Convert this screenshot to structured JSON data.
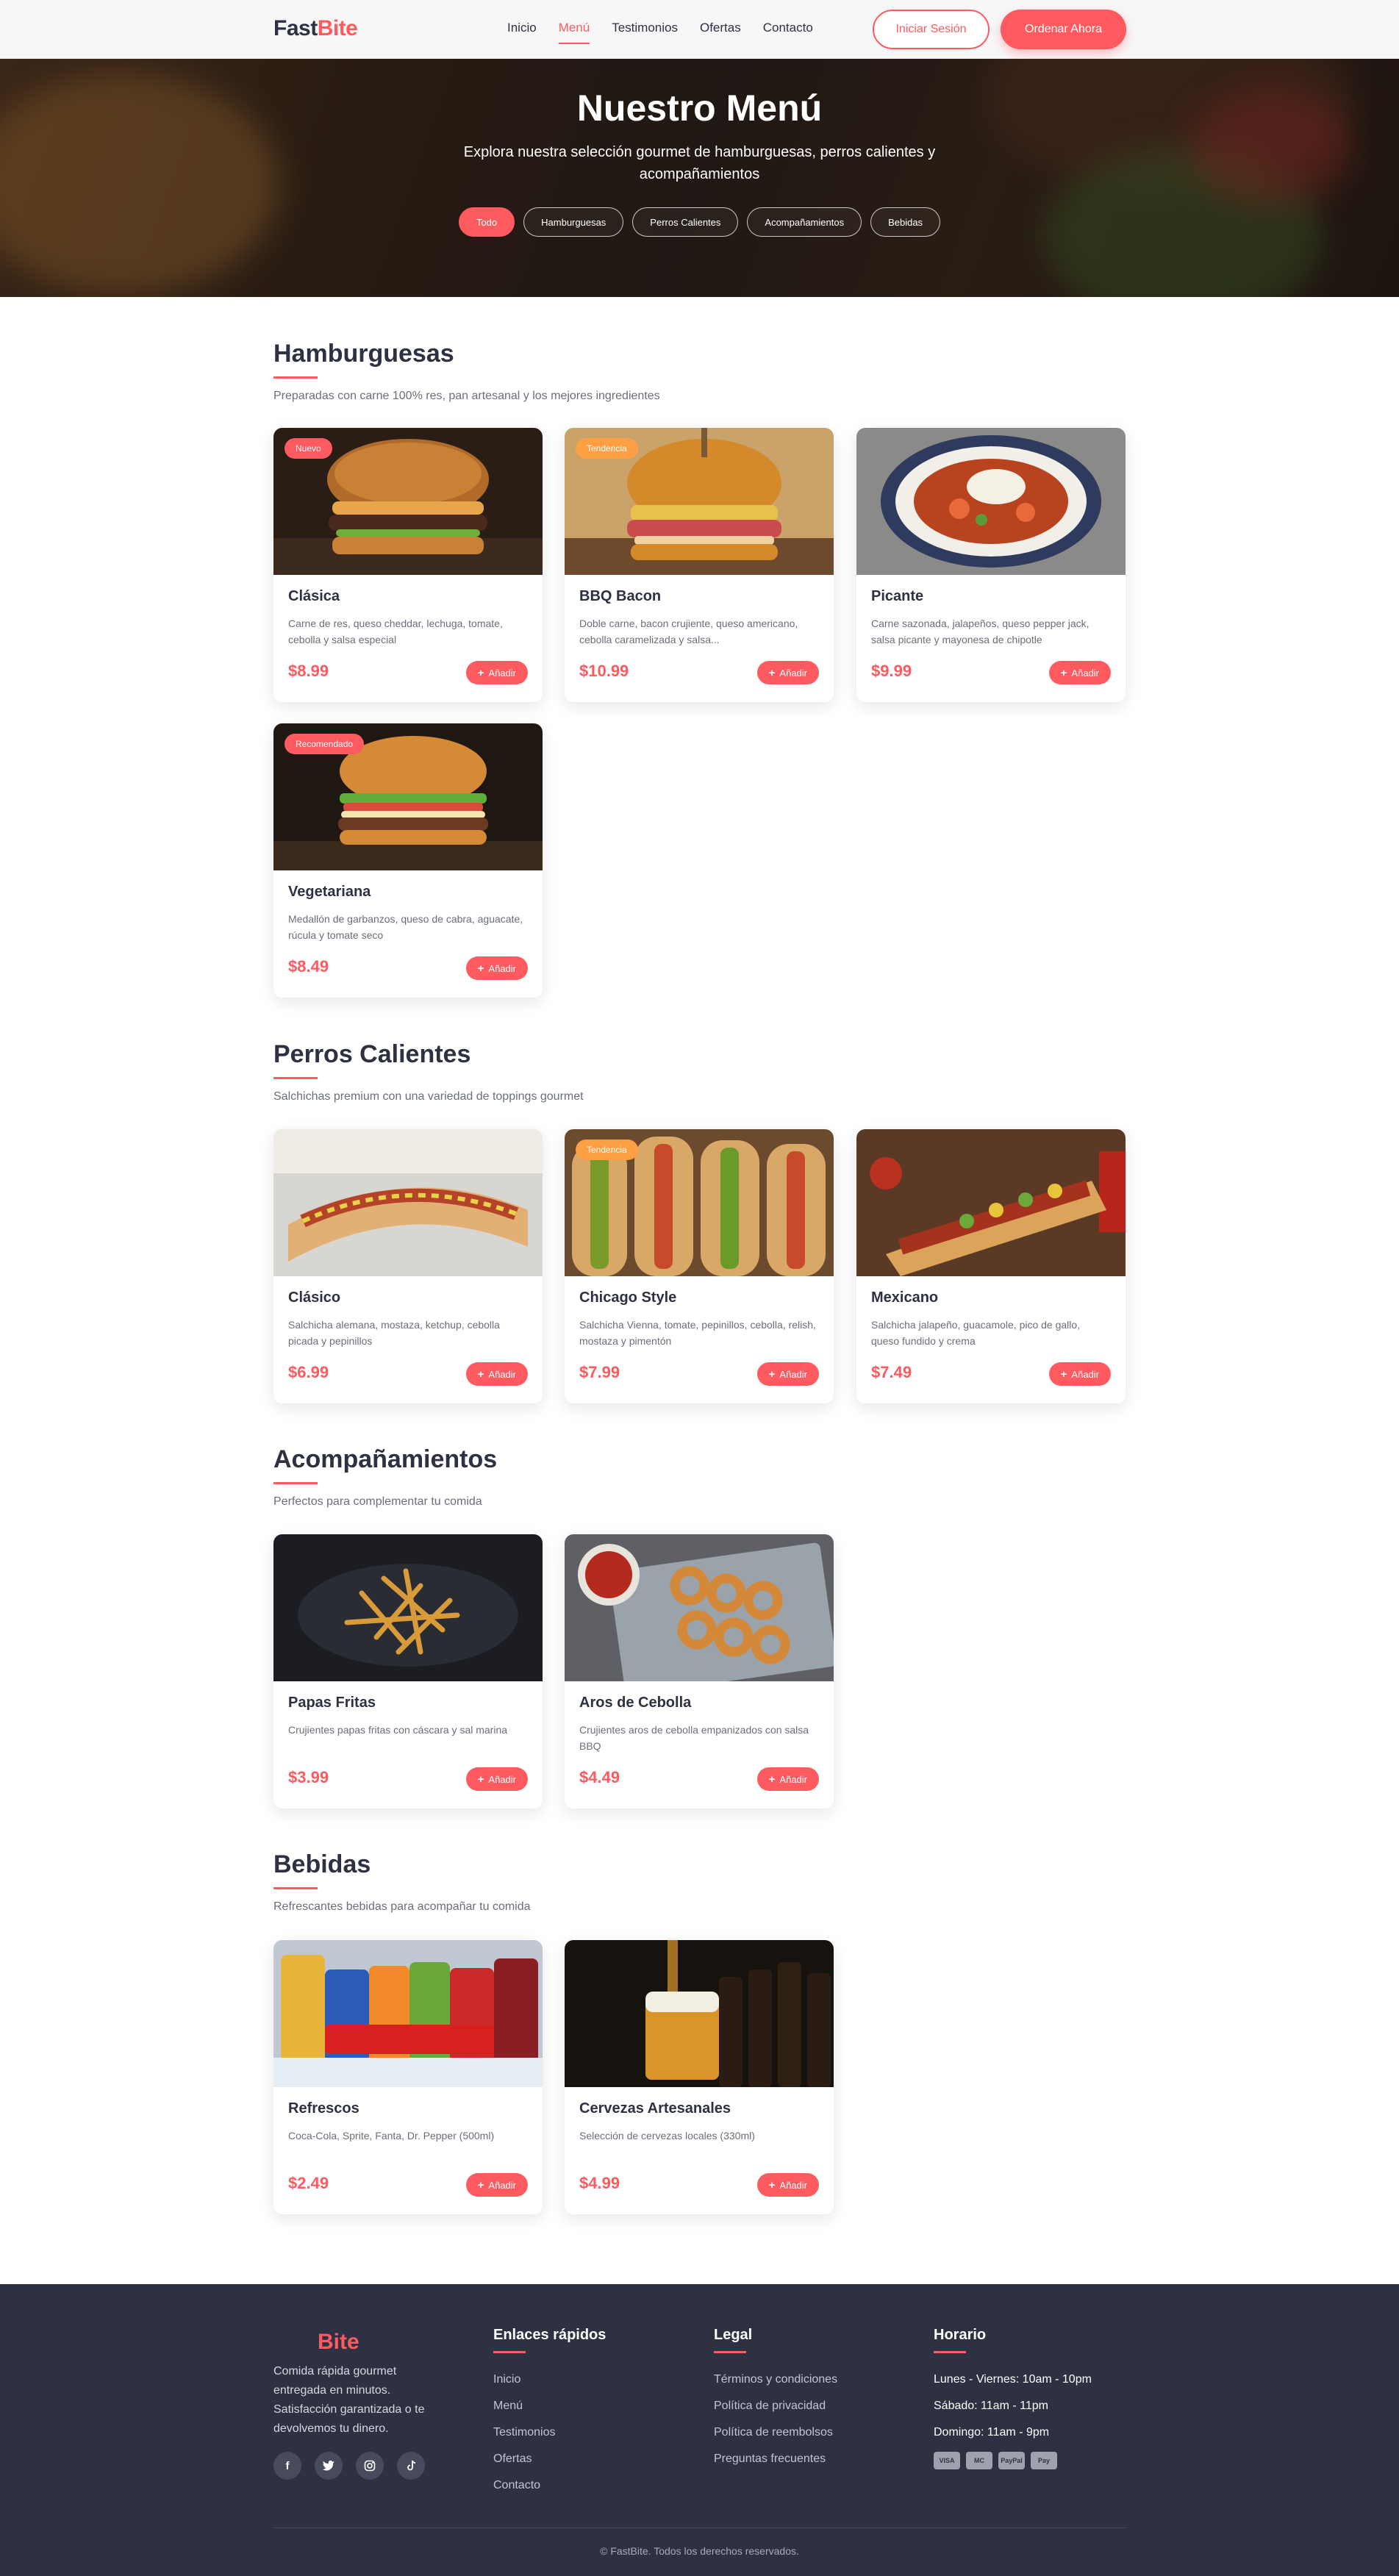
{
  "nav": {
    "logo_part1": "Fast",
    "logo_part2": "Bite",
    "links": [
      "Inicio",
      "Menú",
      "Testimonios",
      "Ofertas",
      "Contacto"
    ],
    "active_link": "Menú",
    "login_label": "Iniciar Sesión",
    "order_label": "Ordenar Ahora"
  },
  "hero": {
    "title": "Nuestro Menú",
    "subtitle": "Explora nuestra selección gourmet de hamburguesas, perros calientes y acompañamientos",
    "filters": [
      "Todo",
      "Hamburguesas",
      "Perros Calientes",
      "Acompañamientos",
      "Bebidas"
    ],
    "active_filter": "Todo"
  },
  "add_label": "Añadir",
  "sections": [
    {
      "title": "Hamburguesas",
      "description": "Preparadas con carne 100% res, pan artesanal y los mejores ingredientes",
      "items": [
        {
          "name": "Clásica",
          "desc": "Carne de res, queso cheddar, lechuga, tomate, cebolla y salsa especial",
          "price": "$8.99",
          "badge": "Nuevo",
          "image": "burger-classic-image"
        },
        {
          "name": "BBQ Bacon",
          "desc": "Doble carne, bacon crujiente, queso americano, cebolla caramelizada y salsa...",
          "price": "$10.99",
          "badge": "Tendencia",
          "image": "burger-bbq-image"
        },
        {
          "name": "Picante",
          "desc": "Carne sazonada, jalapeños, queso pepper jack, salsa picante y mayonesa de chipotle",
          "price": "$9.99",
          "badge": "",
          "image": "spicy-bowl-image"
        },
        {
          "name": "Vegetariana",
          "desc": "Medallón de garbanzos, queso de cabra, aguacate, rúcula y tomate seco",
          "price": "$8.49",
          "badge": "Recomendado",
          "image": "burger-veggie-image"
        }
      ]
    },
    {
      "title": "Perros Calientes",
      "description": "Salchichas premium con una variedad de toppings gourmet",
      "items": [
        {
          "name": "Clásico",
          "desc": "Salchicha alemana, mostaza, ketchup, cebolla picada y pepinillos",
          "price": "$6.99",
          "badge": "",
          "image": "hotdog-classic-image"
        },
        {
          "name": "Chicago Style",
          "desc": "Salchicha Vienna, tomate, pepinillos, cebolla, relish, mostaza y pimentón",
          "price": "$7.99",
          "badge": "Tendencia",
          "image": "hotdog-chicago-image"
        },
        {
          "name": "Mexicano",
          "desc": "Salchicha jalapeño, guacamole, pico de gallo, queso fundido y crema",
          "price": "$7.49",
          "badge": "",
          "image": "hotdog-mexican-image"
        }
      ]
    },
    {
      "title": "Acompañamientos",
      "description": "Perfectos para complementar tu comida",
      "items": [
        {
          "name": "Papas Fritas",
          "desc": "Crujientes papas fritas con cáscara y sal marina",
          "price": "$3.99",
          "badge": "",
          "image": "fries-image"
        },
        {
          "name": "Aros de Cebolla",
          "desc": "Crujientes aros de cebolla empanizados con salsa BBQ",
          "price": "$4.49",
          "badge": "",
          "image": "onion-rings-image"
        }
      ]
    },
    {
      "title": "Bebidas",
      "description": "Refrescantes bebidas para acompañar tu comida",
      "items": [
        {
          "name": "Refrescos",
          "desc": "Coca-Cola, Sprite, Fanta, Dr. Pepper (500ml)",
          "price": "$2.49",
          "badge": "",
          "image": "sodas-image"
        },
        {
          "name": "Cervezas Artesanales",
          "desc": "Selección de cervezas locales (330ml)",
          "price": "$4.99",
          "badge": "",
          "image": "beers-image"
        }
      ]
    }
  ],
  "footer": {
    "logo": "Bite",
    "about": "Comida rápida gourmet entregada en minutos. Satisfacción garantizada o te devolvemos tu dinero.",
    "socials": [
      "facebook-icon",
      "twitter-icon",
      "instagram-icon",
      "tiktok-icon"
    ],
    "quick_links_title": "Enlaces rápidos",
    "quick_links": [
      "Inicio",
      "Menú",
      "Testimonios",
      "Ofertas",
      "Contacto"
    ],
    "legal_title": "Legal",
    "legal_links": [
      "Términos y condiciones",
      "Política de privacidad",
      "Política de reembolsos",
      "Preguntas frecuentes"
    ],
    "hours_title": "Horario",
    "hours": [
      "Lunes - Viernes: 10am - 10pm",
      "Sábado: 11am - 11pm",
      "Domingo: 11am - 9pm"
    ],
    "payments": [
      "VISA",
      "MC",
      "PayPal",
      "Pay"
    ],
    "copyright": "© FastBite. Todos los derechos reservados."
  },
  "colors": {
    "accent": "#ff5a5f",
    "badge_orange": "#ff9f43",
    "dark": "#2d3142"
  }
}
